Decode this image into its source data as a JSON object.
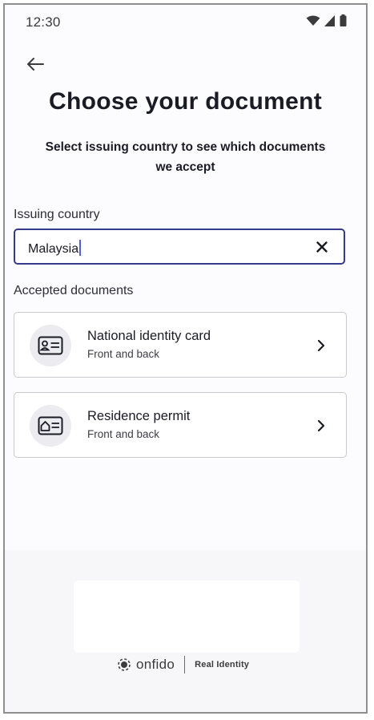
{
  "status_bar": {
    "time": "12:30",
    "icons": [
      "wifi-icon",
      "cellular-signal-icon",
      "battery-icon"
    ]
  },
  "header": {
    "back_icon": "arrow-left-icon",
    "title": "Choose your document",
    "subtitle": "Select issuing country to see which documents we accept"
  },
  "country_field": {
    "label": "Issuing country",
    "value": "Malaysia",
    "clear_icon": "close-icon"
  },
  "documents": {
    "section_label": "Accepted documents",
    "items": [
      {
        "name": "National identity card",
        "sides": "Front and back",
        "icon": "id-card-icon"
      },
      {
        "name": "Residence permit",
        "sides": "Front and back",
        "icon": "residence-permit-icon"
      }
    ]
  },
  "footer": {
    "brand_name": "onfido",
    "tagline": "Real Identity"
  },
  "colors": {
    "accent": "#353a8c",
    "text": "#1b1b25",
    "card_border": "#c9c9cf",
    "icon_background": "#ebebf0"
  }
}
